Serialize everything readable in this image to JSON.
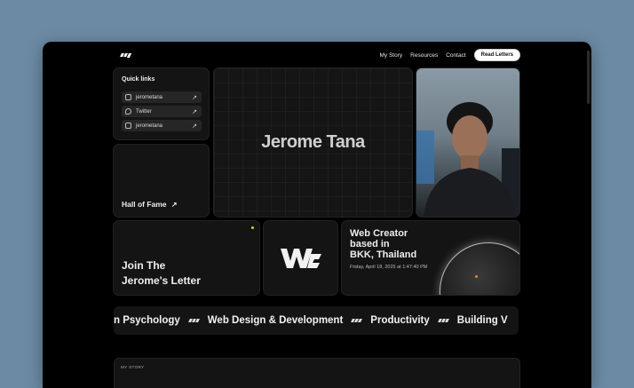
{
  "nav": {
    "links": [
      "My Story",
      "Resources",
      "Contact"
    ],
    "cta_label": "Read Letters"
  },
  "quick_links": {
    "title": "Quick links",
    "items": [
      {
        "label": "jerometana",
        "icon": "instagram-icon"
      },
      {
        "label": "Twitter",
        "icon": "twitter-icon"
      },
      {
        "label": "jerometana",
        "icon": "linkedin-icon"
      }
    ]
  },
  "hall_of_fame": {
    "label": "Hall of Fame"
  },
  "hero": {
    "name": "Jerome Tana"
  },
  "newsletter": {
    "line1": "Join The",
    "line2": "Jerome's Letter"
  },
  "location": {
    "line1": "Web Creator",
    "line2": "based in",
    "line3": "BKK, Thailand",
    "datetime": "Friday, April 18, 2025 at 1:47:40 PM"
  },
  "marquee": {
    "items": [
      "n Psychology",
      "Web Design & Development",
      "Productivity",
      "Building V"
    ]
  },
  "story": {
    "label": "MY STORY"
  },
  "colors": {
    "page_bg": "#6c8aa4",
    "frame_bg": "#000000",
    "card_bg": "#141414",
    "accent_dot": "#c8d23a",
    "globe_dot": "#ff7a33"
  }
}
